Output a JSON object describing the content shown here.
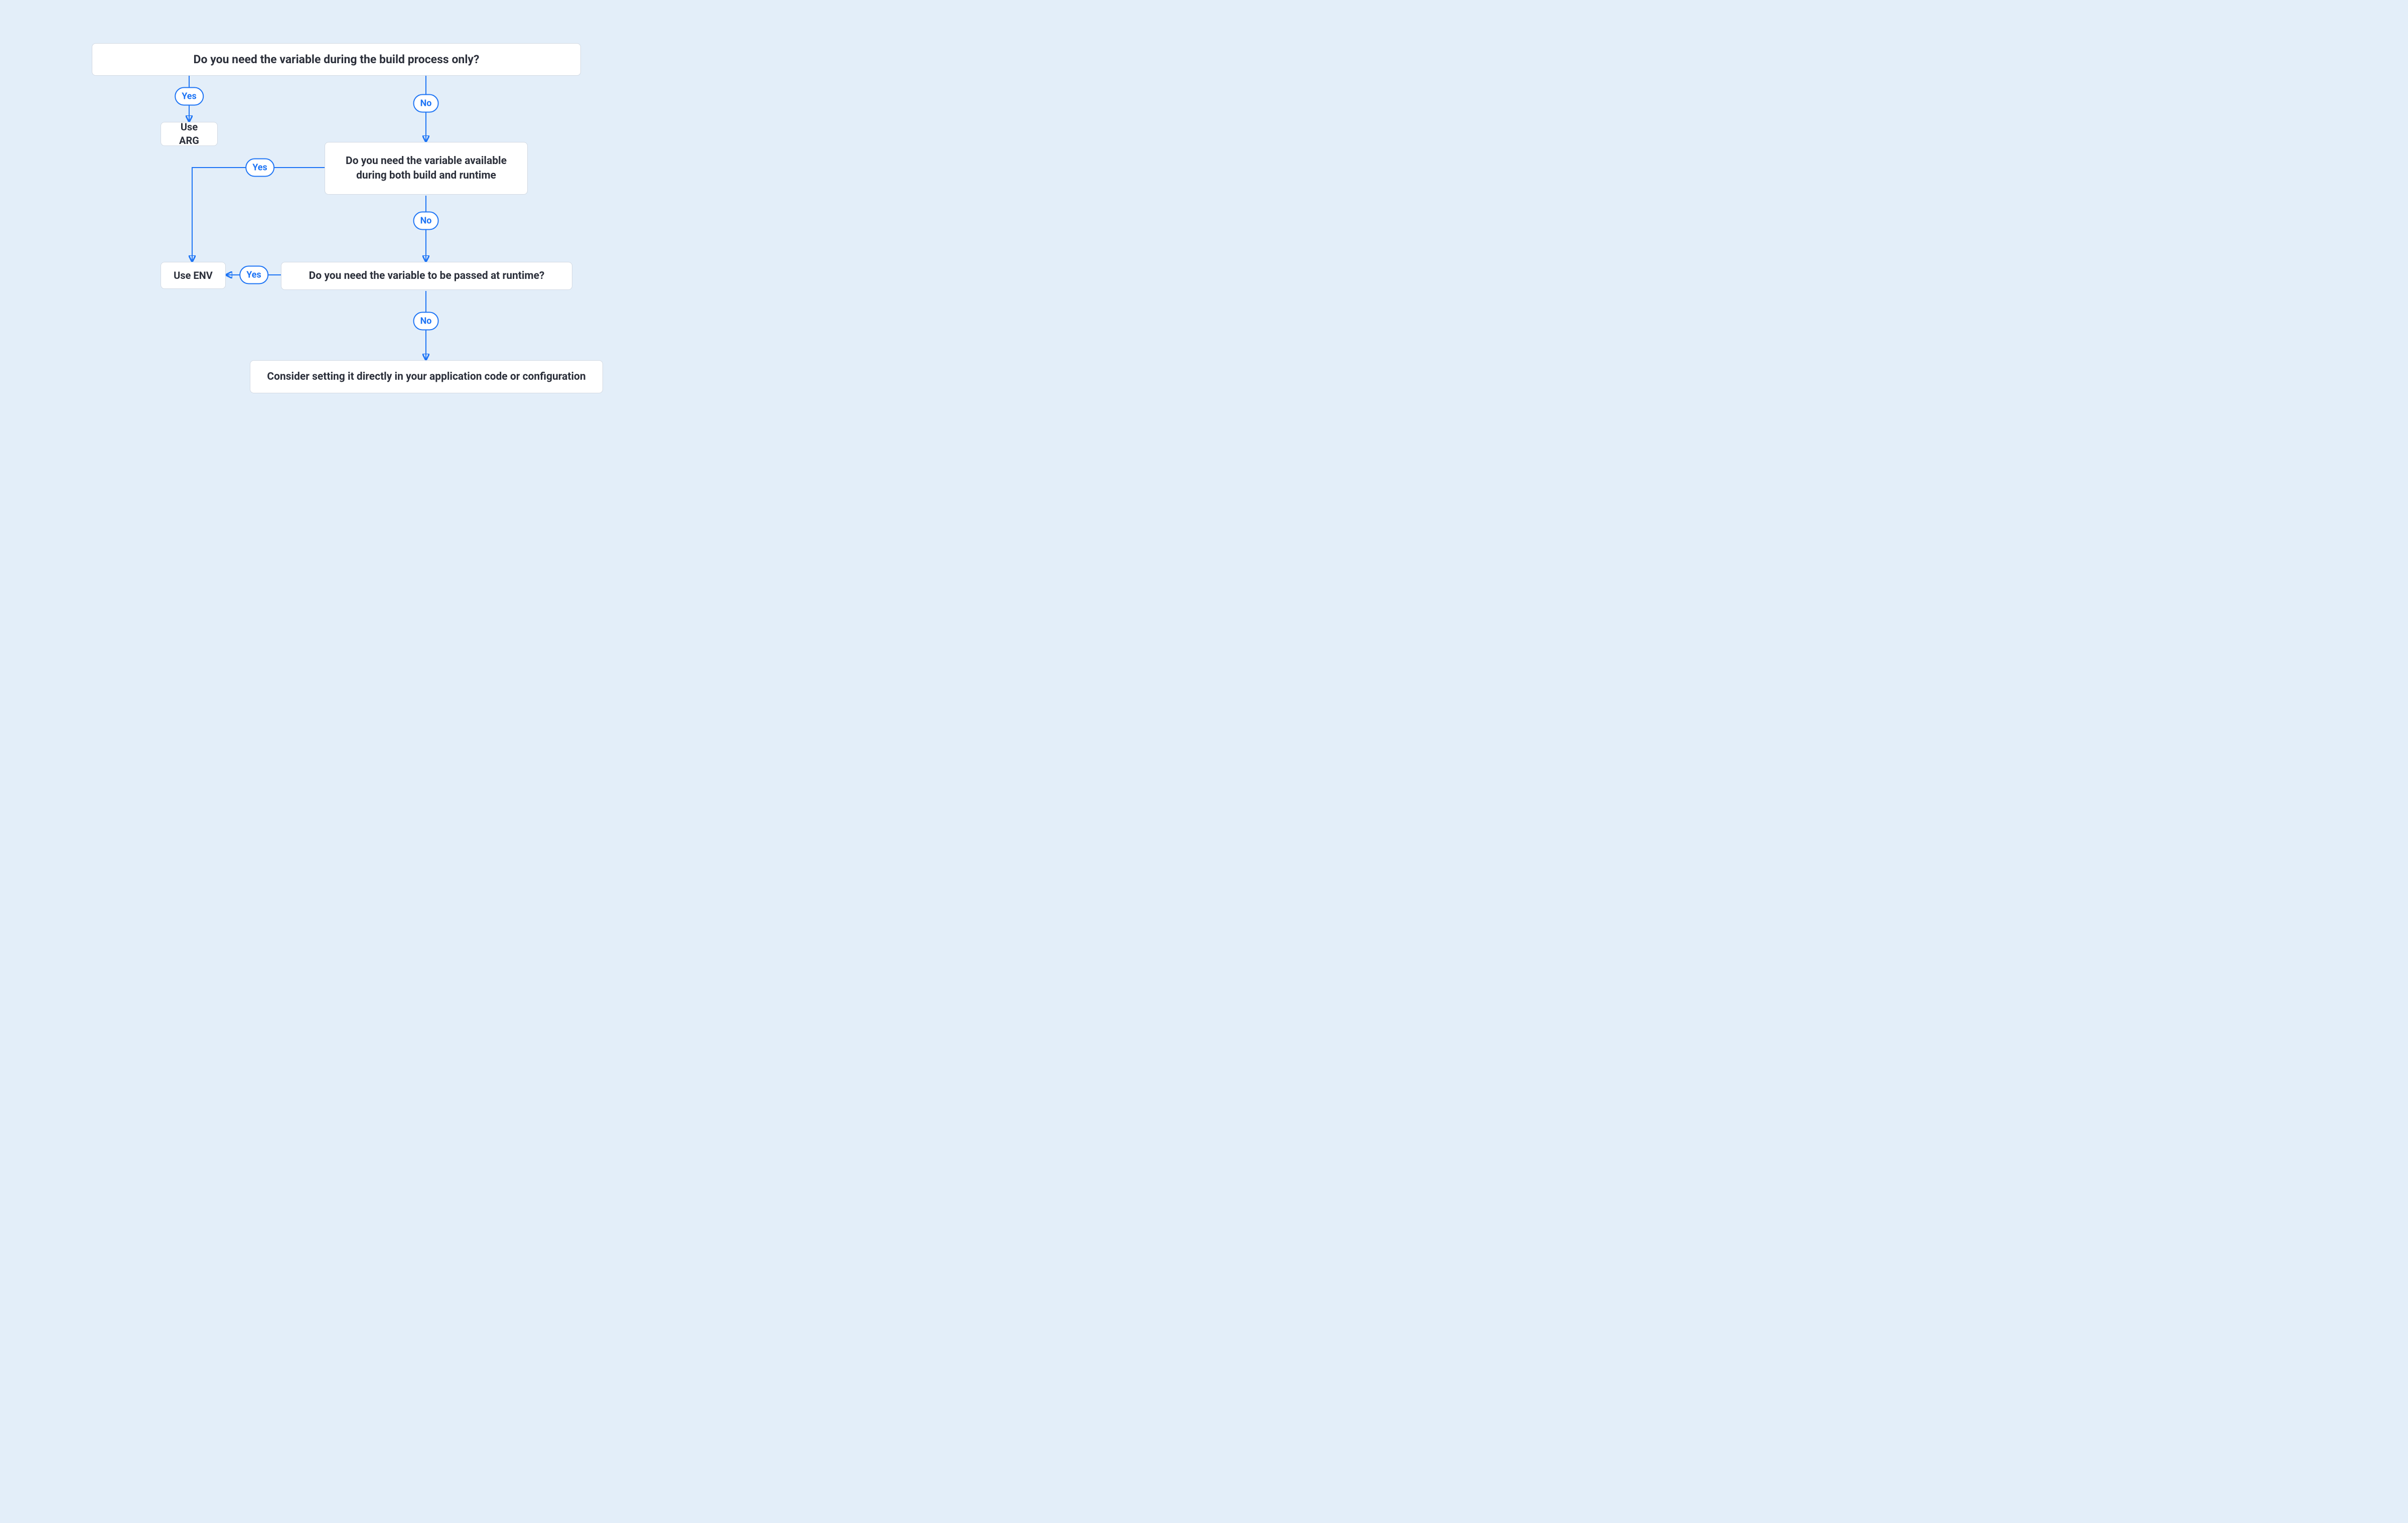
{
  "colors": {
    "bg": "#e3eef9",
    "node_bg": "#ffffff",
    "node_border": "#d2d9e3",
    "text": "#2b2f3a",
    "accent": "#1d74f5"
  },
  "nodes": {
    "q1": "Do you need the variable during the build process only?",
    "a1": "Use ARG",
    "q2": "Do you need the variable available during both build and runtime",
    "a2": "Use ENV",
    "q3": "Do you need the variable to be passed at runtime?",
    "a3": "Consider setting it directly in your application code or configuration"
  },
  "labels": {
    "yes": "Yes",
    "no": "No"
  },
  "edges": [
    {
      "from": "q1",
      "label": "yes",
      "to": "a1"
    },
    {
      "from": "q1",
      "label": "no",
      "to": "q2"
    },
    {
      "from": "q2",
      "label": "yes",
      "to": "a2"
    },
    {
      "from": "q2",
      "label": "no",
      "to": "q3"
    },
    {
      "from": "q3",
      "label": "yes",
      "to": "a2"
    },
    {
      "from": "q3",
      "label": "no",
      "to": "a3"
    }
  ]
}
